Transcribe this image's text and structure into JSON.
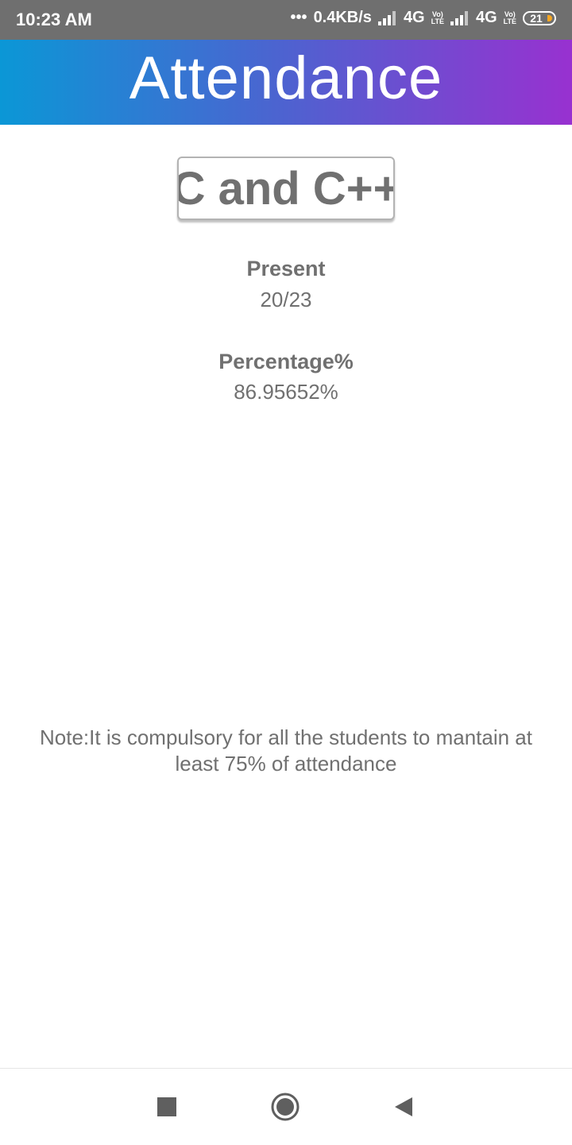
{
  "status_bar": {
    "time": "10:23 AM",
    "network_speed": "0.4KB/s",
    "sim1_type": "4G",
    "sim2_type": "4G",
    "volte_top": "Vo)",
    "volte_bottom": "LTE",
    "battery_level": "21"
  },
  "header": {
    "title": "Attendance"
  },
  "subject": {
    "name": "C and C++"
  },
  "present": {
    "label": "Present",
    "value": "20/23"
  },
  "percentage": {
    "label": "Percentage%",
    "value": "86.95652%"
  },
  "note": {
    "text": "Note:It is compulsory for all the students to mantain at least 75% of attendance"
  },
  "nav": {
    "icons": [
      "recents-icon",
      "home-icon",
      "back-icon"
    ]
  }
}
